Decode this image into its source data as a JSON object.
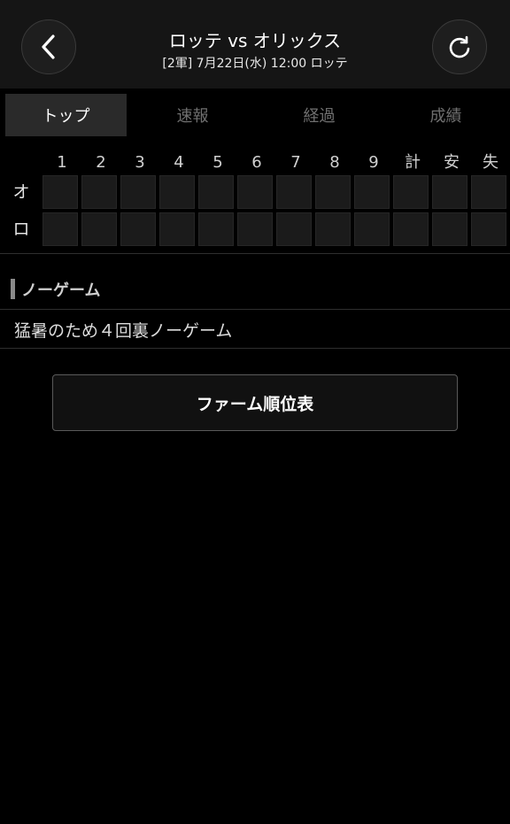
{
  "header": {
    "title": "ロッテ vs オリックス",
    "subtitle": "[2軍] 7月22日(水) 12:00 ロッテ",
    "back_icon": "chevron-left-icon",
    "reload_icon": "reload-icon"
  },
  "tabs": [
    {
      "label": "トップ",
      "active": true
    },
    {
      "label": "速報",
      "active": false
    },
    {
      "label": "経過",
      "active": false
    },
    {
      "label": "成績",
      "active": false
    }
  ],
  "scoreboard": {
    "columns": [
      "1",
      "2",
      "3",
      "4",
      "5",
      "6",
      "7",
      "8",
      "9",
      "計",
      "安",
      "失"
    ],
    "rows": [
      {
        "team": "オ",
        "values": [
          "",
          "",
          "",
          "",
          "",
          "",
          "",
          "",
          "",
          "",
          "",
          ""
        ]
      },
      {
        "team": "ロ",
        "values": [
          "",
          "",
          "",
          "",
          "",
          "",
          "",
          "",
          "",
          "",
          "",
          ""
        ]
      }
    ]
  },
  "section": {
    "title": "ノーゲーム",
    "note": "猛暑のため４回裏ノーゲーム"
  },
  "farm_button": {
    "label": "ファーム順位表"
  }
}
